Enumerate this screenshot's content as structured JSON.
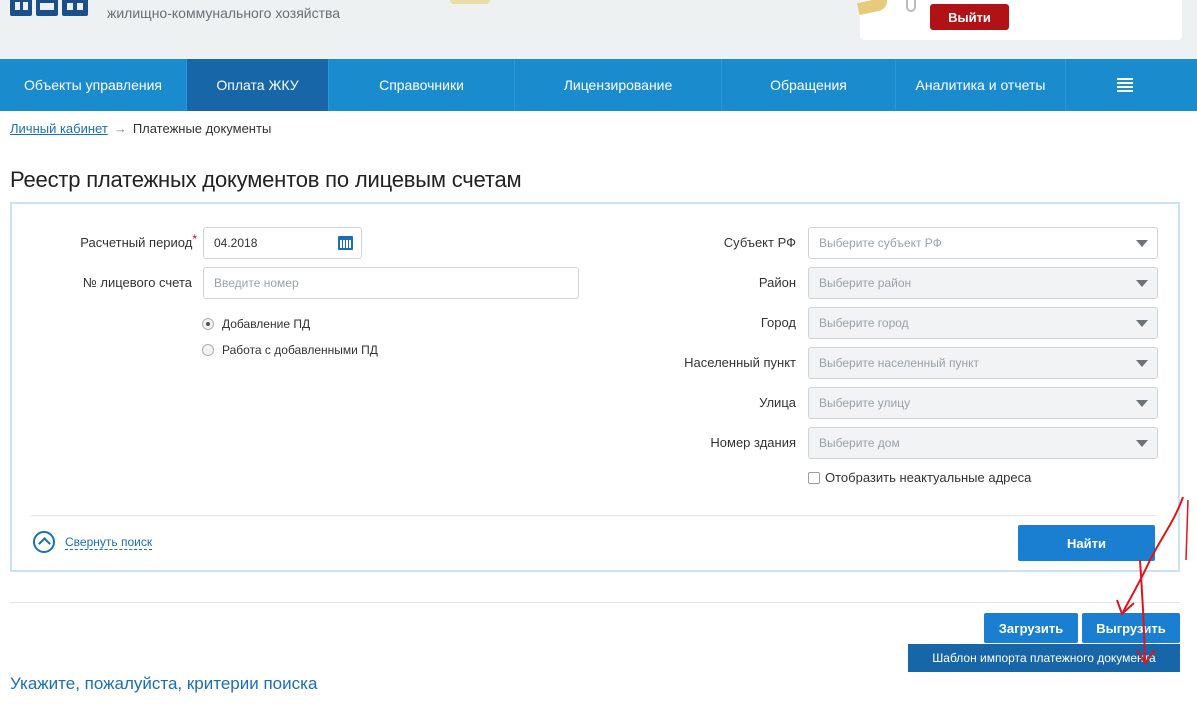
{
  "header": {
    "subtitle": "жилищно-коммунального хозяйства",
    "logout_label": "Выйти"
  },
  "nav": {
    "items": [
      {
        "label": "Объекты управления"
      },
      {
        "label": "Оплата ЖКУ",
        "active": true
      },
      {
        "label": "Справочники"
      },
      {
        "label": "Лицензирование"
      },
      {
        "label": "Обращения"
      },
      {
        "label": "Аналитика и отчеты"
      }
    ],
    "menu_icon": "menu-icon"
  },
  "breadcrumb": {
    "home": "Личный кабинет",
    "separator": "→",
    "current": "Платежные документы"
  },
  "page_title": "Реестр платежных документов по лицевым счетам",
  "search": {
    "period_label": "Расчетный период",
    "required_mark": "*",
    "period_value": "04.2018",
    "account_label": "№ лицевого счета",
    "account_placeholder": "Введите номер",
    "radio_add": "Добавление ПД",
    "radio_work": "Работа с добавленными ПД",
    "radio_selected": "Добавление ПД",
    "subject_label": "Субъект РФ",
    "subject_placeholder": "Выберите субъект РФ",
    "district_label": "Район",
    "district_placeholder": "Выберите район",
    "city_label": "Город",
    "city_placeholder": "Выберите город",
    "settlement_label": "Населенный пункт",
    "settlement_placeholder": "Выберите населенный пункт",
    "street_label": "Улица",
    "street_placeholder": "Выберите улицу",
    "building_label": "Номер здания",
    "building_placeholder": "Выберите дом",
    "show_inactive_label": "Отобразить неактуальные адреса",
    "collapse_label": "Свернуть поиск",
    "find_label": "Найти"
  },
  "actions": {
    "upload_label": "Загрузить",
    "download_label": "Выгрузить",
    "template_label": "Шаблон импорта платежного документа"
  },
  "hint": "Укажите, пожалуйста, критерии поиска",
  "colors": {
    "nav": "#1a8bcd",
    "nav_active": "#1766a7",
    "logout": "#b01216",
    "primary_button": "#1a7fd0",
    "annotation": "#e0141c"
  }
}
